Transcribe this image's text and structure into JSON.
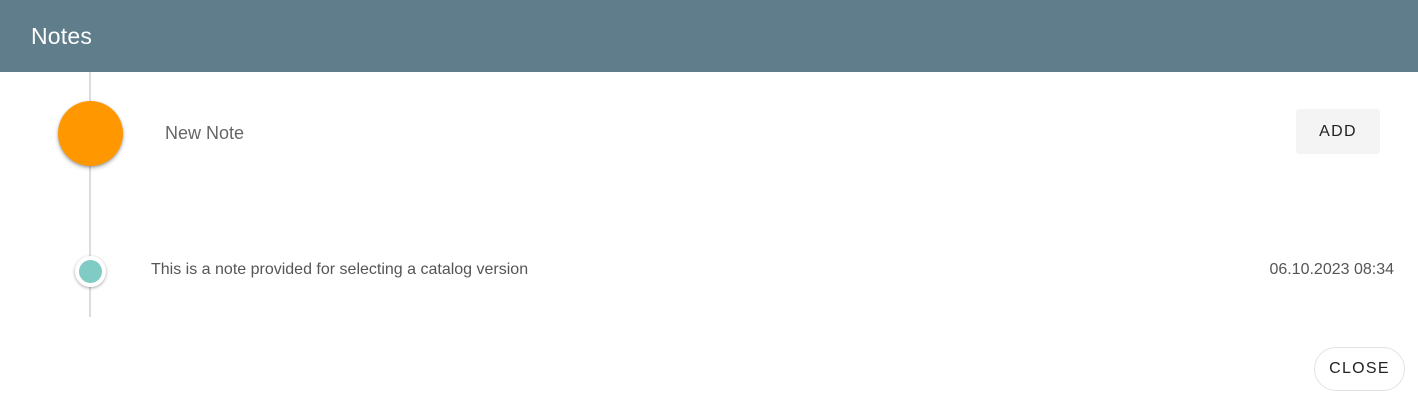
{
  "dialog": {
    "title": "Notes",
    "header_color": "#607d8b"
  },
  "new_note": {
    "placeholder": "New Note",
    "value": "",
    "add_label": "ADD",
    "marker_color": "#ff9800"
  },
  "notes": [
    {
      "text": "This is a note provided for selecting a catalog version",
      "timestamp": "06.10.2023 08:34",
      "marker_color": "#80cbc4"
    }
  ],
  "footer": {
    "close_label": "CLOSE"
  }
}
